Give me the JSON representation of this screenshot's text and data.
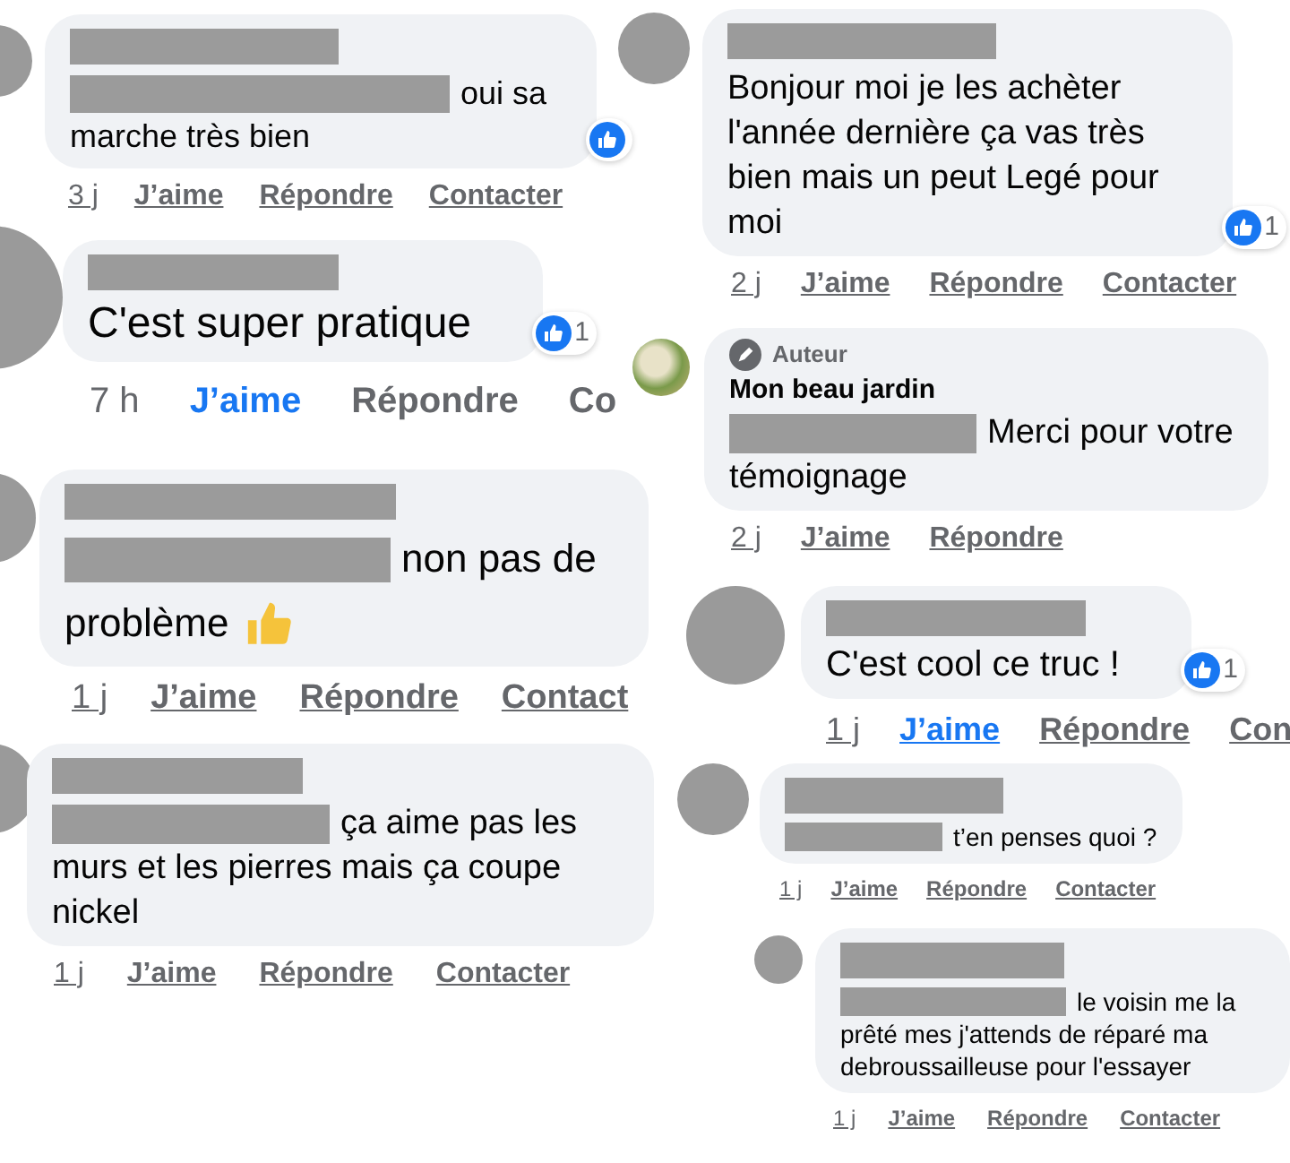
{
  "columns": [
    {
      "comments": [
        {
          "author": {
            "kind": "redacted"
          },
          "lines": [
            {
              "redacted": true,
              "text": "oui sa"
            },
            {
              "text": "marche très bien"
            }
          ],
          "reacted": true,
          "actions": [
            {
              "kind": "time",
              "text": "3 j"
            },
            {
              "kind": "like",
              "text": "J’aime",
              "selected": false
            },
            {
              "kind": "reply",
              "text": "Répondre"
            },
            {
              "kind": "contact",
              "text": "Contacter"
            }
          ]
        },
        {
          "author": {
            "kind": "redacted"
          },
          "lines": [
            {
              "text": "C'est super pratique"
            }
          ],
          "reacted": true,
          "reaction_count": "1",
          "actions": [
            {
              "kind": "time",
              "text": "7 h"
            },
            {
              "kind": "like",
              "text": "J’aime",
              "selected": true
            },
            {
              "kind": "reply",
              "text": "Répondre"
            },
            {
              "kind": "contact",
              "text": "Co"
            }
          ]
        },
        {
          "author": {
            "kind": "redacted"
          },
          "lines": [
            {
              "redacted": true,
              "text": "non pas de"
            },
            {
              "text": "problème",
              "thumb": true
            }
          ],
          "actions": [
            {
              "kind": "time",
              "text": "1 j"
            },
            {
              "kind": "like",
              "text": "J’aime",
              "selected": false
            },
            {
              "kind": "reply",
              "text": "Répondre"
            },
            {
              "kind": "contact",
              "text": "Contact"
            }
          ]
        },
        {
          "author": {
            "kind": "redacted"
          },
          "lines": [
            {
              "redacted": true,
              "text": "ça aime pas les"
            },
            {
              "text": "murs et les pierres mais ça coupe nickel"
            }
          ],
          "actions": [
            {
              "kind": "time",
              "text": "1 j"
            },
            {
              "kind": "like",
              "text": "J’aime",
              "selected": false
            },
            {
              "kind": "reply",
              "text": "Répondre"
            },
            {
              "kind": "contact",
              "text": "Contacter"
            }
          ]
        }
      ]
    },
    {
      "comments": [
        {
          "author": {
            "kind": "redacted"
          },
          "lines": [
            {
              "text": "Bonjour moi je les achèter l'année dernière ça vas très bien mais un peut Legé pour moi"
            }
          ],
          "reacted": true,
          "reaction_count": "1",
          "actions": [
            {
              "kind": "time",
              "text": "2 j"
            },
            {
              "kind": "like",
              "text": "J’aime",
              "selected": false
            },
            {
              "kind": "reply",
              "text": "Répondre"
            },
            {
              "kind": "contact",
              "text": "Contacter"
            }
          ]
        },
        {
          "badge": "Auteur",
          "author": {
            "kind": "name",
            "text": "Mon beau jardin"
          },
          "lines": [
            {
              "redacted": true,
              "text": "Merci pour votre"
            },
            {
              "text": "témoignage"
            }
          ],
          "actions": [
            {
              "kind": "time",
              "text": "2 j"
            },
            {
              "kind": "like",
              "text": "J’aime",
              "selected": false
            },
            {
              "kind": "reply",
              "text": "Répondre"
            }
          ]
        },
        {
          "author": {
            "kind": "redacted"
          },
          "lines": [
            {
              "text": "C'est cool ce truc !"
            }
          ],
          "reacted": true,
          "reaction_count": "1",
          "actions": [
            {
              "kind": "time",
              "text": "1 j"
            },
            {
              "kind": "like",
              "text": "J’aime",
              "selected": true
            },
            {
              "kind": "reply",
              "text": "Répondre"
            },
            {
              "kind": "contact",
              "text": "Con"
            }
          ]
        },
        {
          "author": {
            "kind": "redacted"
          },
          "lines": [
            {
              "redacted": true,
              "text": "t’en penses quoi ?"
            }
          ],
          "actions": [
            {
              "kind": "time",
              "text": "1 j"
            },
            {
              "kind": "like",
              "text": "J’aime",
              "selected": false
            },
            {
              "kind": "reply",
              "text": "Répondre"
            },
            {
              "kind": "contact",
              "text": "Contacter"
            }
          ]
        },
        {
          "author": {
            "kind": "redacted"
          },
          "lines": [
            {
              "redacted": true,
              "text": "le voisin me la"
            },
            {
              "text": "prêté mes j'attends de réparé ma debroussailleuse pour l'essayer"
            }
          ],
          "actions": [
            {
              "kind": "time",
              "text": "1 j"
            },
            {
              "kind": "like",
              "text": "J’aime",
              "selected": false
            },
            {
              "kind": "reply",
              "text": "Répondre"
            },
            {
              "kind": "contact",
              "text": "Contacter"
            }
          ]
        }
      ]
    }
  ]
}
